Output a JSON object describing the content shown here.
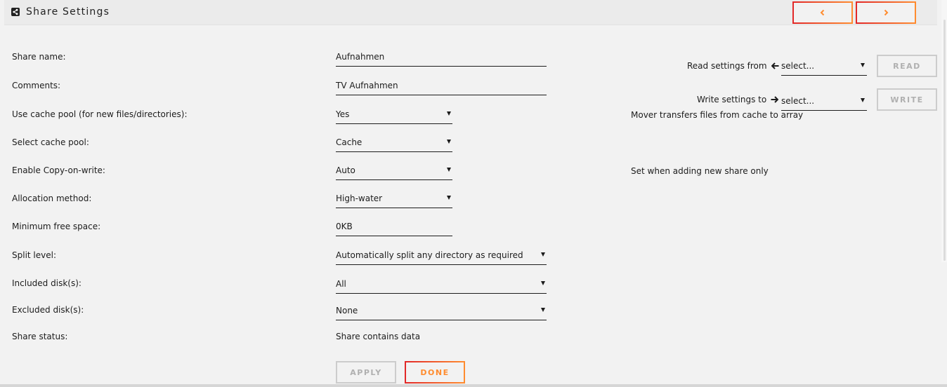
{
  "header": {
    "title": "Share Settings",
    "icons": {
      "share": "share-icon",
      "prev": "chevron-left-icon",
      "next": "chevron-right-icon"
    }
  },
  "form": {
    "share_name": {
      "label": "Share name:",
      "value": "Aufnahmen"
    },
    "comments": {
      "label": "Comments:",
      "value": "TV Aufnahmen"
    },
    "use_cache": {
      "label": "Use cache pool (for new files/directories):",
      "value": "Yes"
    },
    "cache_pool": {
      "label": "Select cache pool:",
      "value": "Cache"
    },
    "copy_on_write": {
      "label": "Enable Copy-on-write:",
      "value": "Auto"
    },
    "allocation": {
      "label": "Allocation method:",
      "value": "High-water"
    },
    "min_free": {
      "label": "Minimum free space:",
      "value": "0KB"
    },
    "split_level": {
      "label": "Split level:",
      "value": "Automatically split any directory as required"
    },
    "included": {
      "label": "Included disk(s):",
      "value": "All"
    },
    "excluded": {
      "label": "Excluded disk(s):",
      "value": "None"
    },
    "status": {
      "label": "Share status:",
      "value": "Share contains data"
    }
  },
  "notes": {
    "mover": "Mover transfers files from cache to array",
    "cow": "Set when adding new share only"
  },
  "settings": {
    "read_label": "Read settings from",
    "read_value": "select...",
    "read_button": "READ",
    "write_label": "Write settings to",
    "write_value": "select...",
    "write_button": "WRITE"
  },
  "actions": {
    "apply": "APPLY",
    "done": "DONE"
  },
  "colors": {
    "accent_red": "#e22828",
    "accent_orange": "#ff8c2f",
    "disabled": "#b0b0b0"
  }
}
